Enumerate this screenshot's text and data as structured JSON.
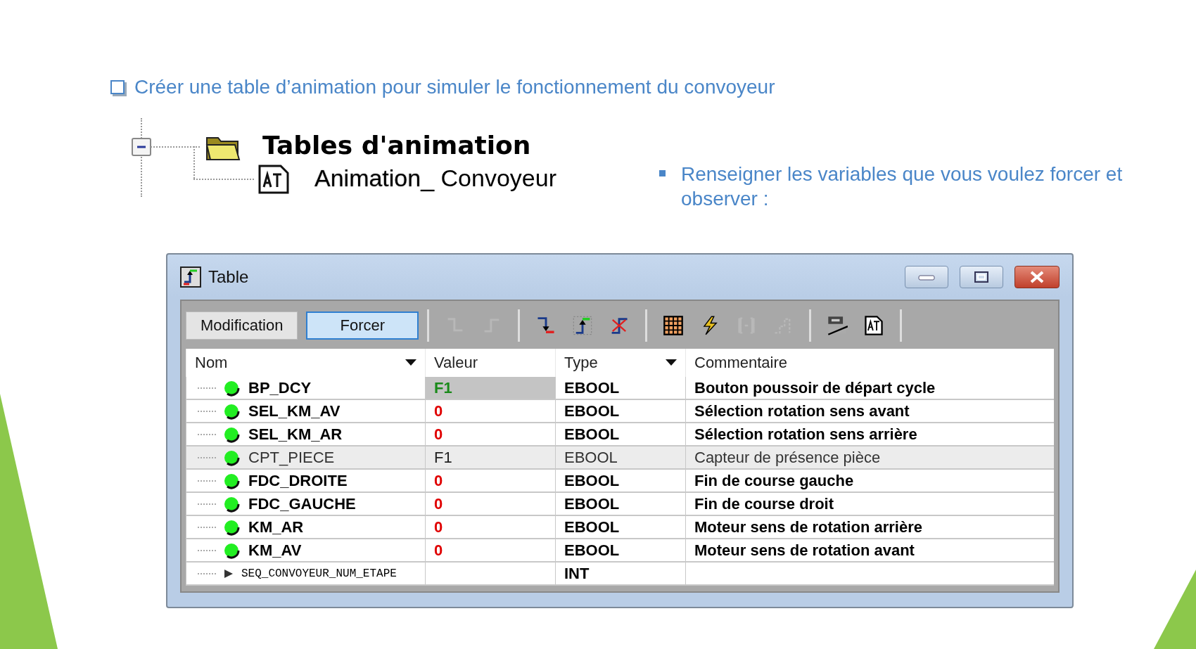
{
  "slide": {
    "heading": "Créer une table d’animation pour simuler le fonctionnement du convoyeur",
    "tree": {
      "folder_label": "Tables d'animation",
      "expanded": true,
      "children": [
        {
          "label_prefix": "Animation_",
          "label_suffix": " Convoyeur"
        }
      ]
    },
    "instruction": "Renseigner les variables que vous voulez forcer et observer :"
  },
  "window": {
    "title": "Table",
    "mode_buttons": [
      {
        "label": "Modification",
        "selected": false
      },
      {
        "label": "Forcer",
        "selected": true
      }
    ],
    "toolbar_groups": [
      [
        {
          "kind": "force-low",
          "disabled": true
        },
        {
          "kind": "force-high",
          "disabled": true
        }
      ],
      [
        {
          "kind": "set-low",
          "disabled": false
        },
        {
          "kind": "set-high",
          "disabled": false
        },
        {
          "kind": "unforce",
          "disabled": false
        }
      ],
      [
        {
          "kind": "grid",
          "disabled": false
        },
        {
          "kind": "lightning",
          "disabled": false
        },
        {
          "kind": "bracket",
          "disabled": true
        },
        {
          "kind": "step",
          "disabled": true
        }
      ],
      [
        {
          "kind": "display",
          "disabled": false
        },
        {
          "kind": "doc",
          "disabled": false
        }
      ]
    ],
    "table": {
      "columns": [
        {
          "label": "Nom",
          "dropdown": true
        },
        {
          "label": "Valeur",
          "dropdown": false
        },
        {
          "label": "Type",
          "dropdown": true
        },
        {
          "label": "Commentaire",
          "dropdown": false
        }
      ],
      "rows": [
        {
          "kind": "variable",
          "name": "BP_DCY",
          "value": "F1",
          "color": "#1a8a1a",
          "value_highlighted": true,
          "type": "EBOOL",
          "comment": "Bouton poussoir de départ cycle",
          "selected": false
        },
        {
          "kind": "variable",
          "name": "SEL_KM_AV",
          "value": "0",
          "color": "#e00000",
          "value_highlighted": false,
          "type": "EBOOL",
          "comment": "Sélection rotation sens avant",
          "selected": false
        },
        {
          "kind": "variable",
          "name": "SEL_KM_AR",
          "value": "0",
          "color": "#e00000",
          "value_highlighted": false,
          "type": "EBOOL",
          "comment": "Sélection rotation sens arrière",
          "selected": false
        },
        {
          "kind": "variable",
          "name": "CPT_PIECE",
          "value": "F1",
          "color": "#222222",
          "value_highlighted": false,
          "type": "EBOOL",
          "comment": "Capteur de présence pièce",
          "selected": true
        },
        {
          "kind": "variable",
          "name": "FDC_DROITE",
          "value": "0",
          "color": "#e00000",
          "value_highlighted": false,
          "type": "EBOOL",
          "comment": "Fin de course gauche",
          "selected": false
        },
        {
          "kind": "variable",
          "name": "FDC_GAUCHE",
          "value": "0",
          "color": "#e00000",
          "value_highlighted": false,
          "type": "EBOOL",
          "comment": "Fin de course droit",
          "selected": false
        },
        {
          "kind": "variable",
          "name": "KM_AR",
          "value": "0",
          "color": "#e00000",
          "value_highlighted": false,
          "type": "EBOOL",
          "comment": "Moteur sens de rotation arrière",
          "selected": false
        },
        {
          "kind": "variable",
          "name": "KM_AV",
          "value": "0",
          "color": "#e00000",
          "value_highlighted": false,
          "type": "EBOOL",
          "comment": "Moteur sens de rotation avant",
          "selected": false
        },
        {
          "kind": "structure",
          "name": "SEQ_CONVOYEUR_NUM_ETAPE",
          "type": "INT",
          "selected": false
        }
      ]
    }
  }
}
